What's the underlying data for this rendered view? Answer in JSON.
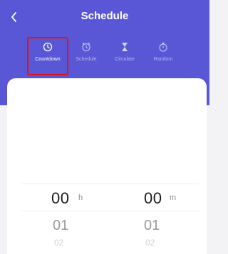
{
  "header": {
    "title": "Schedule",
    "back_icon": "chevron-left-icon",
    "background": "#5a57d6"
  },
  "tabs": [
    {
      "label": "Countdown",
      "icon": "clock-icon",
      "active": true
    },
    {
      "label": "Schedule",
      "icon": "alarm-icon",
      "active": false
    },
    {
      "label": "Circulate",
      "icon": "hourglass-icon",
      "active": false
    },
    {
      "label": "Random",
      "icon": "stopwatch-icon",
      "active": false
    }
  ],
  "picker": {
    "hours": {
      "selected": "00",
      "unit": "h",
      "next": "01",
      "next2": "02"
    },
    "minutes": {
      "selected": "00",
      "unit": "m",
      "next": "01",
      "next2": "02"
    }
  },
  "colors": {
    "accent": "#5a57d6",
    "highlight": "#e0141e"
  }
}
